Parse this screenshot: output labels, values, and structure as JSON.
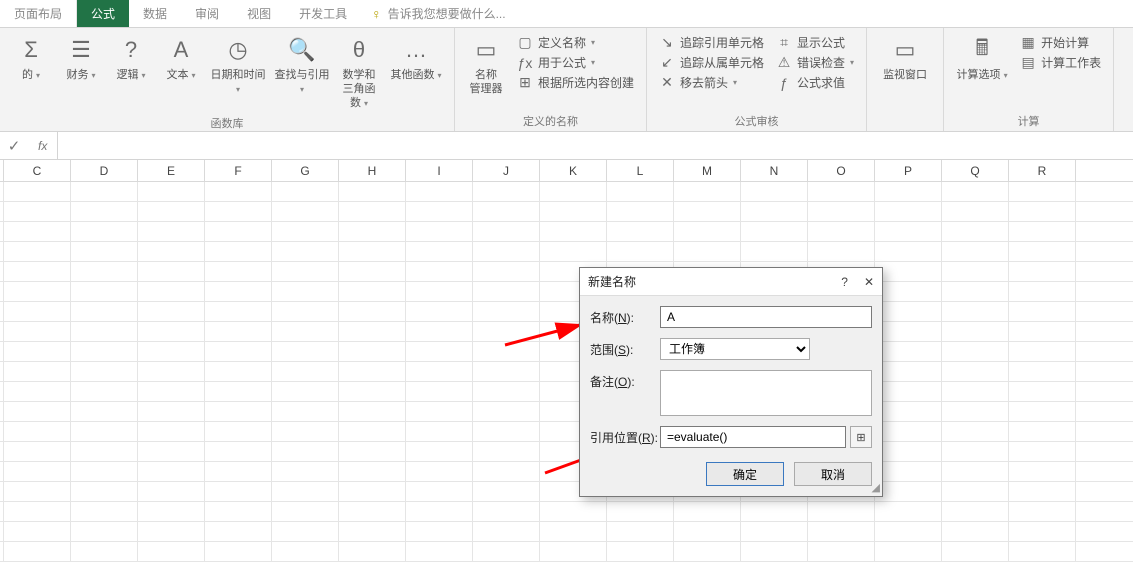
{
  "tabs": {
    "page_layout": "页面布局",
    "formulas": "公式",
    "data": "数据",
    "review": "审阅",
    "view": "视图",
    "dev_tools": "开发工具",
    "tell_me": "告诉我您想要做什么..."
  },
  "ribbon": {
    "group_library_label": "函数库",
    "group_defined_names_label": "定义的名称",
    "group_formula_audit_label": "公式审核",
    "group_calc_label": "计算",
    "btn_truncated": "的",
    "btn_financial": "财务",
    "btn_logical": "逻辑",
    "btn_text": "文本",
    "btn_datetime": "日期和时间",
    "btn_lookup": "查找与引用",
    "btn_math_trig1": "数学和",
    "btn_math_trig2": "三角函数",
    "btn_more_fn": "其他函数",
    "btn_name_mgr1": "名称",
    "btn_name_mgr2": "管理器",
    "row_define_name": "定义名称",
    "row_use_in_formula": "用于公式",
    "row_create_from_sel": "根据所选内容创建",
    "row_trace_prec": "追踪引用单元格",
    "row_trace_dep": "追踪从属单元格",
    "row_remove_arrows": "移去箭头",
    "row_show_formulas": "显示公式",
    "row_error_check": "错误检查",
    "row_eval_formula": "公式求值",
    "btn_watch_window": "监视窗口",
    "btn_calc_options": "计算选项",
    "row_calc_now": "开始计算",
    "row_calc_sheet": "计算工作表"
  },
  "formula_bar": {
    "fx": "fx",
    "value": ""
  },
  "columns": [
    "C",
    "D",
    "E",
    "F",
    "G",
    "H",
    "I",
    "J",
    "K",
    "L",
    "M",
    "N",
    "O",
    "P",
    "Q",
    "R"
  ],
  "dialog": {
    "title": "新建名称",
    "name_label": "名称(",
    "name_key": "N",
    "name_suffix": "):",
    "name_value": "A",
    "scope_label": "范围(",
    "scope_key": "S",
    "scope_suffix": "):",
    "scope_value": "工作簿",
    "comment_label": "备注(",
    "comment_key": "O",
    "comment_suffix": "):",
    "comment_value": "",
    "refersto_label": "引用位置(",
    "refersto_key": "R",
    "refersto_suffix": "):",
    "refersto_value": "=evaluate()",
    "ok": "确定",
    "cancel": "取消",
    "help": "?"
  }
}
